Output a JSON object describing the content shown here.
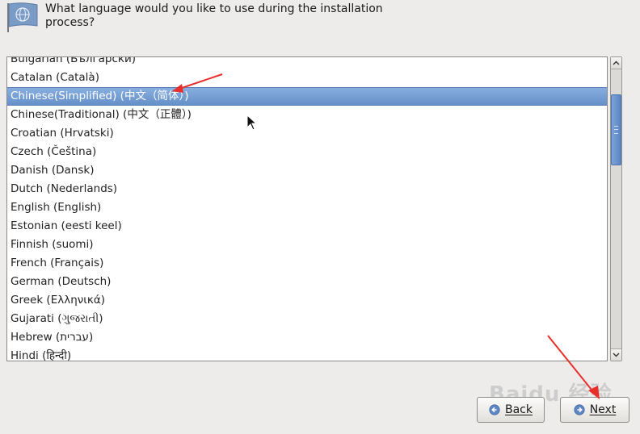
{
  "header": {
    "prompt": "What language would you like to use during the installation process?"
  },
  "language_list": {
    "items": [
      "Bulgarian (Български)",
      "Catalan (Català)",
      "Chinese(Simplified) (中文（简体）)",
      "Chinese(Traditional) (中文（正體）)",
      "Croatian (Hrvatski)",
      "Czech (Čeština)",
      "Danish (Dansk)",
      "Dutch (Nederlands)",
      "English (English)",
      "Estonian (eesti keel)",
      "Finnish (suomi)",
      "French (Français)",
      "German (Deutsch)",
      "Greek (Ελληνικά)",
      "Gujarati (ગુજરાતી)",
      "Hebrew (עברית)",
      "Hindi (हिन्दी)"
    ],
    "selected_index": 2
  },
  "buttons": {
    "back_label": "Back",
    "next_label": "Next"
  },
  "watermark": "Baidu 经验",
  "colors": {
    "selection": "#6f97cf",
    "scroll_thumb": "#6a93cc",
    "annotation_arrow": "#e8302a"
  }
}
